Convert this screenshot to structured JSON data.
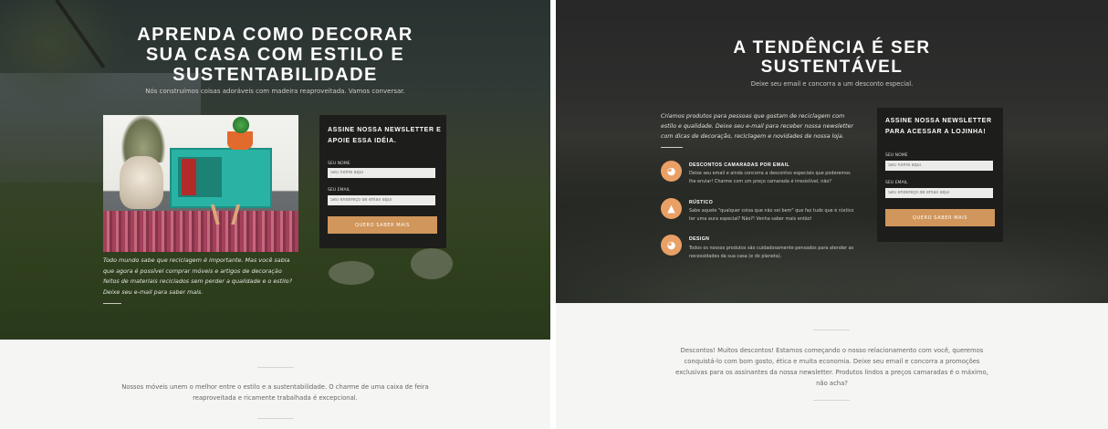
{
  "left": {
    "hero_title_lines": [
      "APRENDA COMO DECORAR",
      "SUA CASA COM ESTILO E",
      "SUSTENTABILIDADE"
    ],
    "hero_subtitle": "Nós construímos coisas adoráveis com madeira reaproveitada. Vamos conversar.",
    "caption": "Todo mundo sabe que reciclagem é importante. Mas você sabia que agora é possível comprar móveis e artigos de decoração feitos de materiais reciclados sem perder a qualidade e o estilo? Deixe seu e-mail para saber mais.",
    "form": {
      "title_lines": [
        "ASSINE NOSSA NEWSLETTER E",
        "APOIE ESSA IDÉIA."
      ],
      "name_label": "SEU NOME",
      "name_placeholder": "Seu nome aqui",
      "email_label": "SEU EMAIL",
      "email_placeholder": "Seu endereço de email aqui",
      "button": "QUERO SABER MAIS"
    },
    "footer_lines": [
      "Nossos móveis unem o melhor entre o estilo e a sustentabilidade. O charme de uma caixa de feira",
      "reaproveitada e ricamente trabalhada é excepcional."
    ]
  },
  "right": {
    "hero_title_lines": [
      "A TENDÊNCIA É SER",
      "SUSTENTÁVEL"
    ],
    "hero_subtitle": "Deixe seu email e concorra a um desconto especial.",
    "intro": "Criamos produtos para pessoas que gostam de reciclagem com estilo e qualidade. Deixe seu e-mail para receber nossa newsletter com dicas de decoração, reciclagem e novidades de nossa loja.",
    "features": [
      {
        "icon": "lightbulb-icon",
        "title": "DESCONTOS CAMARADAS POR EMAIL",
        "text": "Deixe seu email e ainda concorra a descontos especiais que poderemos lhe enviar! Charme com um preço camarada é irresistível, não?"
      },
      {
        "icon": "tree-icon",
        "title": "RÚSTICO",
        "text": "Sabe aquele \"qualquer coisa que não sei bem\" que faz tudo que é rústico ter uma aura especial? Não?! Venha saber mais então!"
      },
      {
        "icon": "lightbulb-icon",
        "title": "DESIGN",
        "text": "Todos os nossos produtos são cuidadosamente pensados para atender as necessidades da sua casa (e do planeta)."
      }
    ],
    "form": {
      "title_lines": [
        "ASSINE NOSSA NEWSLETTER",
        "PARA ACESSAR A LOJINHA!"
      ],
      "name_label": "SEU NOME",
      "name_placeholder": "Seu nome aqui",
      "email_label": "SEU EMAIL",
      "email_placeholder": "Seu endereço de email aqui",
      "button": "QUERO SABER MAIS"
    },
    "footer_lines": [
      "Descontos! Muitos descontos! Estamos começando o nosso relacionamento com você, queremos",
      "conquistá-lo com bom gosto, ética e muita economia. Deixe seu email e concorra a promoções",
      "exclusivas para os assinantes da nossa newsletter. Produtos lindos a preços camaradas é o máximo,",
      "não acha?"
    ]
  },
  "colors": {
    "accent": "#d0965b",
    "icon_circle": "#e9a066",
    "form_bg": "#1d1d1b",
    "footer_bg": "#f5f5f3"
  }
}
